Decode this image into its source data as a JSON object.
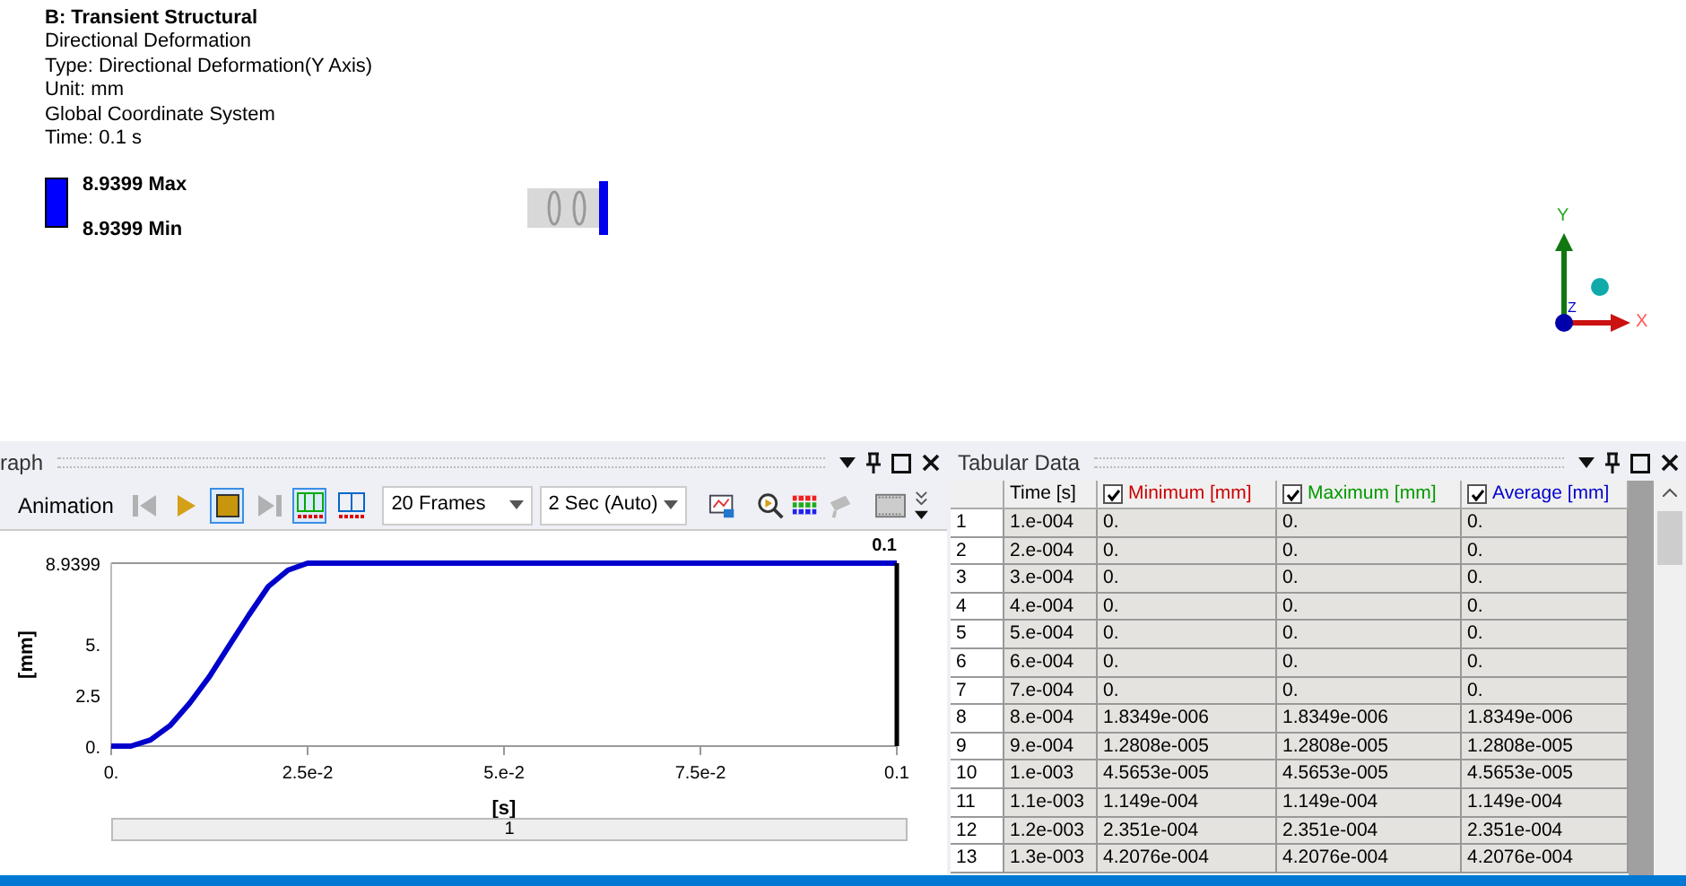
{
  "viewport": {
    "lines": [
      {
        "kind": "title",
        "text": "B: Transient Structural"
      },
      {
        "kind": "line",
        "text": "Directional Deformation"
      },
      {
        "kind": "line",
        "text": "Type: Directional Deformation(Y Axis)"
      },
      {
        "kind": "line",
        "text": "Unit: mm"
      },
      {
        "kind": "line",
        "text": "Global Coordinate System"
      },
      {
        "kind": "line",
        "text": "Time: 0.1 s"
      }
    ],
    "legend": {
      "max": "8.9399 Max",
      "min": "8.9399 Min"
    },
    "triad": {
      "x": "X",
      "y": "Y",
      "z": "Z"
    }
  },
  "graph_panel": {
    "title": "raph",
    "toolbar_label": "Animation",
    "buttons": [
      {
        "kind": "first",
        "selected": false,
        "disabled": true
      },
      {
        "kind": "play",
        "selected": false,
        "disabled": false
      },
      {
        "kind": "stop",
        "selected": true,
        "disabled": false
      },
      {
        "kind": "last",
        "selected": false,
        "disabled": true
      },
      {
        "kind": "mode-a",
        "selected": true,
        "disabled": false
      },
      {
        "kind": "mode-b",
        "selected": false,
        "disabled": false
      }
    ],
    "frames": "20 Frames",
    "duration": "2 Sec (Auto)",
    "chart_data": {
      "type": "line",
      "xlabel": "[s]",
      "ylabel": "[mm]",
      "x": [
        0,
        0.0025,
        0.005,
        0.0075,
        0.01,
        0.0125,
        0.015,
        0.0175,
        0.02,
        0.0225,
        0.025,
        0.05,
        0.075,
        0.1
      ],
      "series": [
        {
          "color": "#0000cc",
          "values": [
            0,
            0,
            0.3,
            1.0,
            2.1,
            3.4,
            4.9,
            6.4,
            7.8,
            8.6,
            8.9399,
            8.9399,
            8.9399,
            8.9399
          ]
        }
      ],
      "xlim": [
        0,
        0.1
      ],
      "ylim": [
        0,
        8.9399
      ],
      "xticks": [
        {
          "value": 0,
          "label": "0."
        },
        {
          "value": 0.025,
          "label": "2.5e-2"
        },
        {
          "value": 0.05,
          "label": "5.e-2"
        },
        {
          "value": 0.075,
          "label": "7.5e-2"
        },
        {
          "value": 0.1,
          "label": "0.1"
        }
      ],
      "yticks": [
        {
          "value": 0,
          "label": "0."
        },
        {
          "value": 2.5,
          "label": "2.5"
        },
        {
          "value": 5,
          "label": "5."
        },
        {
          "value": 8.9399,
          "label": "8.9399"
        }
      ],
      "annotations": [
        "0.1"
      ]
    },
    "slider": {
      "label": "1",
      "level": 1
    }
  },
  "tabular_panel": {
    "title": "Tabular Data",
    "columns": [
      {
        "kind": "plain",
        "label": "Time [s]",
        "color": "#000000"
      },
      {
        "kind": "checkable",
        "label": "Minimum [mm]",
        "checked": true,
        "color": "#cc0000"
      },
      {
        "kind": "checkable",
        "label": "Maximum [mm]",
        "checked": true,
        "color": "#009900"
      },
      {
        "kind": "checkable",
        "label": "Average [mm]",
        "checked": true,
        "color": "#0000cc"
      }
    ],
    "rows": [
      {
        "number": "1",
        "cells": [
          "1.e-004",
          "0.",
          "0.",
          "0."
        ]
      },
      {
        "number": "2",
        "cells": [
          "2.e-004",
          "0.",
          "0.",
          "0."
        ]
      },
      {
        "number": "3",
        "cells": [
          "3.e-004",
          "0.",
          "0.",
          "0."
        ]
      },
      {
        "number": "4",
        "cells": [
          "4.e-004",
          "0.",
          "0.",
          "0."
        ]
      },
      {
        "number": "5",
        "cells": [
          "5.e-004",
          "0.",
          "0.",
          "0."
        ]
      },
      {
        "number": "6",
        "cells": [
          "6.e-004",
          "0.",
          "0.",
          "0."
        ]
      },
      {
        "number": "7",
        "cells": [
          "7.e-004",
          "0.",
          "0.",
          "0."
        ]
      },
      {
        "number": "8",
        "cells": [
          "8.e-004",
          "1.8349e-006",
          "1.8349e-006",
          "1.8349e-006"
        ]
      },
      {
        "number": "9",
        "cells": [
          "9.e-004",
          "1.2808e-005",
          "1.2808e-005",
          "1.2808e-005"
        ]
      },
      {
        "number": "10",
        "cells": [
          "1.e-003",
          "4.5653e-005",
          "4.5653e-005",
          "4.5653e-005"
        ]
      },
      {
        "number": "11",
        "cells": [
          "1.1e-003",
          "1.149e-004",
          "1.149e-004",
          "1.149e-004"
        ]
      },
      {
        "number": "12",
        "cells": [
          "1.2e-003",
          "2.351e-004",
          "2.351e-004",
          "2.351e-004"
        ]
      },
      {
        "number": "13",
        "cells": [
          "1.3e-003",
          "4.2076e-004",
          "4.2076e-004",
          "4.2076e-004"
        ]
      }
    ]
  }
}
